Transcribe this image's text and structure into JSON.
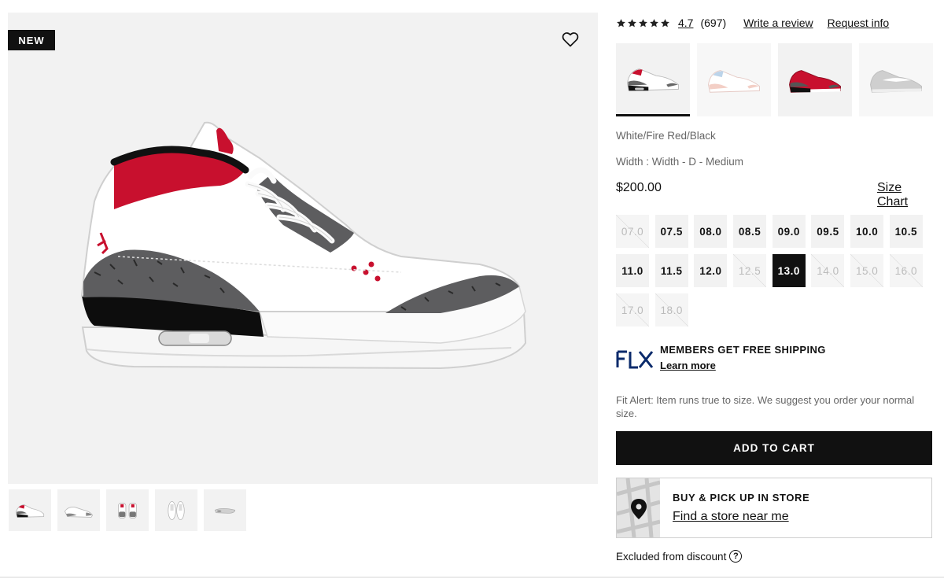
{
  "gallery": {
    "badge": "NEW",
    "favorite_icon": "heart-outline-icon",
    "thumbnails": [
      "side-view",
      "side-view-light",
      "front-pair",
      "top-pair",
      "sole-side"
    ]
  },
  "product": {
    "rating": {
      "stars": 5,
      "value": "4.7",
      "count": "(697)",
      "write_review": "Write a review",
      "request_info": "Request info"
    },
    "variants": [
      {
        "name": "white-fire-red-black",
        "selected": true
      },
      {
        "name": "white-pink",
        "selected": false
      },
      {
        "name": "red-cement",
        "selected": false
      },
      {
        "name": "grey",
        "selected": false
      }
    ],
    "colorway": "White/Fire Red/Black",
    "width": "Width : Width - D - Medium",
    "price": "$200.00",
    "size_chart": "Size Chart",
    "sizes": [
      {
        "label": "07.0",
        "available": false
      },
      {
        "label": "07.5",
        "available": true
      },
      {
        "label": "08.0",
        "available": true
      },
      {
        "label": "08.5",
        "available": true
      },
      {
        "label": "09.0",
        "available": true
      },
      {
        "label": "09.5",
        "available": true
      },
      {
        "label": "10.0",
        "available": true
      },
      {
        "label": "10.5",
        "available": true
      },
      {
        "label": "11.0",
        "available": true
      },
      {
        "label": "11.5",
        "available": true
      },
      {
        "label": "12.0",
        "available": true
      },
      {
        "label": "12.5",
        "available": false
      },
      {
        "label": "13.0",
        "available": true,
        "selected": true
      },
      {
        "label": "14.0",
        "available": false
      },
      {
        "label": "15.0",
        "available": false
      },
      {
        "label": "16.0",
        "available": false
      },
      {
        "label": "17.0",
        "available": false
      },
      {
        "label": "18.0",
        "available": false
      }
    ]
  },
  "promo": {
    "logo_text": "FLX",
    "title": "MEMBERS GET FREE SHIPPING",
    "link": "Learn more"
  },
  "fit_alert": "Fit Alert: Item runs true to size. We suggest you order your normal size.",
  "add_to_cart": "ADD TO CART",
  "pickup": {
    "title": "BUY & PICK UP IN STORE",
    "link": "Find a store near me"
  },
  "excluded": "Excluded from discount",
  "colors": {
    "primary": "#111111",
    "muted": "#666666",
    "tile_bg": "#f2f2f2",
    "accent_red": "#c8102e"
  }
}
